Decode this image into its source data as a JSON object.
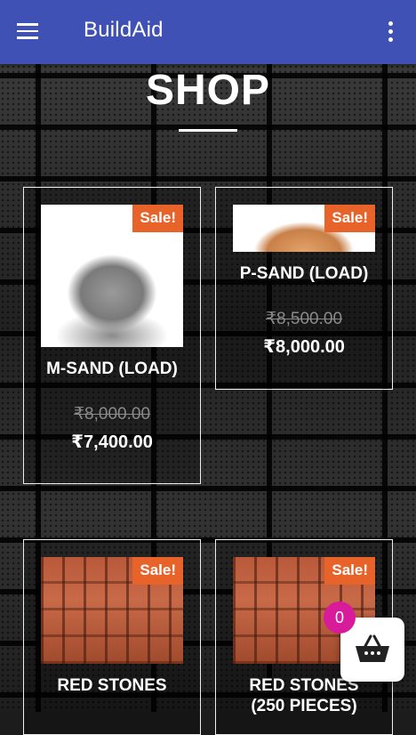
{
  "appbar": {
    "title": "BuildAid"
  },
  "page": {
    "heading": "SHOP"
  },
  "products": [
    {
      "name": "M-SAND (LOAD)",
      "old_price": "₹8,000.00",
      "price": "₹7,400.00",
      "badge": "Sale!",
      "image": "grey-sand-pile"
    },
    {
      "name": "P-SAND (LOAD)",
      "old_price": "₹8,500.00",
      "price": "₹8,000.00",
      "badge": "Sale!",
      "image": "orange-sand-pile"
    },
    {
      "name": "RED STONES",
      "badge": "Sale!",
      "image": "red-stones"
    },
    {
      "name": "RED STONES\n(250 PIECES)",
      "name_line1": "RED STONES",
      "name_line2": "(250 PIECES)",
      "badge": "Sale!",
      "image": "red-stones"
    }
  ],
  "cart": {
    "count": "0",
    "icon": "basket-icon"
  },
  "colors": {
    "appbar": "#3f51b5",
    "sale_badge": "#e8632a",
    "cart_badge": "#d81b9a"
  }
}
